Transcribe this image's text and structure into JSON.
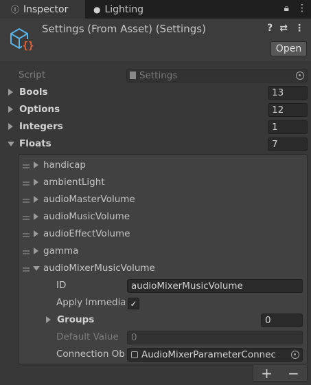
{
  "tabs": [
    {
      "label": "Inspector",
      "icon": "info-icon"
    },
    {
      "label": "Lighting",
      "icon": "lightbulb-icon"
    }
  ],
  "header": {
    "title": "Settings (From Asset) (Settings)",
    "open_label": "Open"
  },
  "script_row": {
    "label": "Script",
    "value": "Settings"
  },
  "groups": [
    {
      "label": "Bools",
      "count": "13"
    },
    {
      "label": "Options",
      "count": "12"
    },
    {
      "label": "Integers",
      "count": "1"
    },
    {
      "label": "Floats",
      "count": "7"
    }
  ],
  "floats_items": [
    "handicap",
    "ambientLight",
    "audioMasterVolume",
    "audioMusicVolume",
    "audioEffectVolume",
    "gamma",
    "audioMixerMusicVolume"
  ],
  "expanded_item": {
    "id_label": "ID",
    "id_value": "audioMixerMusicVolume",
    "apply_label": "Apply Immedia",
    "apply_checked": "✓",
    "groups_label": "Groups",
    "groups_count": "0",
    "default_label": "Default Value",
    "default_value": "0",
    "connection_label": "Connection Ob",
    "connection_value": "AudioMixerParameterConnec"
  },
  "footer": {
    "add": "+",
    "remove": "−"
  }
}
